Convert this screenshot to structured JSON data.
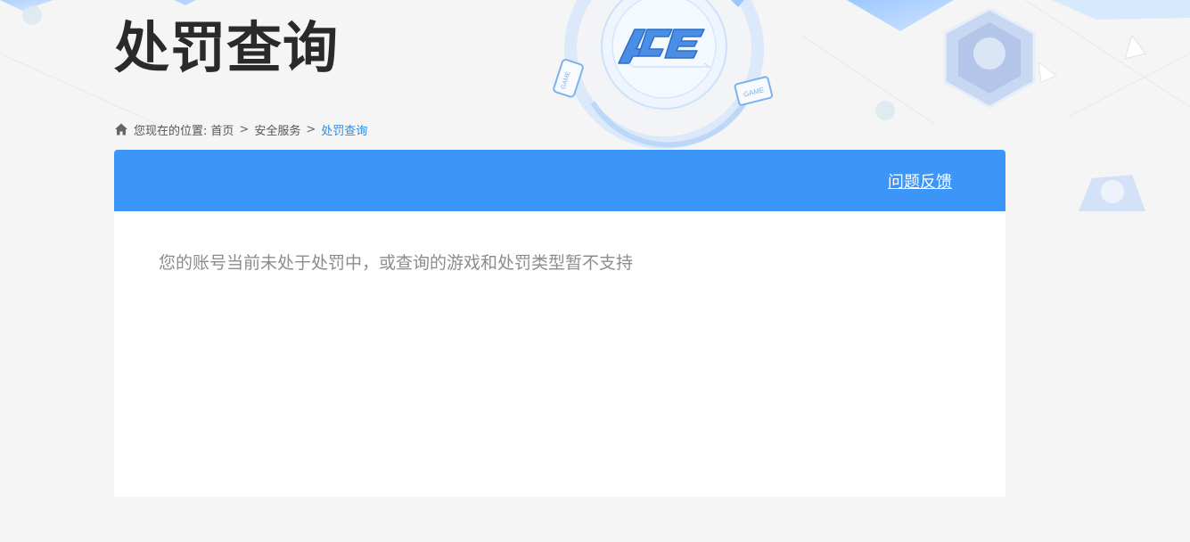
{
  "page": {
    "title": "处罚查询"
  },
  "logo": {
    "text": "ACE",
    "game_badge": "GAME"
  },
  "breadcrumb": {
    "prefix": "您现在的位置:",
    "items": [
      "首页",
      "安全服务",
      "处罚查询"
    ],
    "separator": ">"
  },
  "panel": {
    "feedback_label": "问题反馈",
    "message": "您的账号当前未处于处罚中，或查询的游戏和处罚类型暂不支持"
  },
  "colors": {
    "accent": "#3b96f7",
    "link_active": "#2b8be0"
  }
}
